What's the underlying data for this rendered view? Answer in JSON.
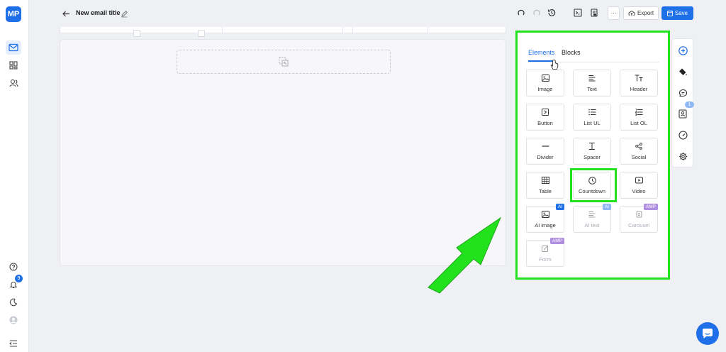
{
  "app": {
    "logo_text": "MP",
    "notification_count": "9"
  },
  "document": {
    "title": "New email title"
  },
  "toolbar": {
    "more_label": "···",
    "export_label": "Export",
    "save_label": "Save"
  },
  "panel": {
    "tabs": [
      {
        "label": "Elements",
        "active": true
      },
      {
        "label": "Blocks",
        "active": false
      }
    ],
    "elements": [
      {
        "label": "Image",
        "icon": "image-icon"
      },
      {
        "label": "Text",
        "icon": "text-lines-icon"
      },
      {
        "label": "Header",
        "icon": "header-tt-icon"
      },
      {
        "label": "Button",
        "icon": "button-icon"
      },
      {
        "label": "List UL",
        "icon": "list-ul-icon"
      },
      {
        "label": "List OL",
        "icon": "list-ol-icon"
      },
      {
        "label": "Divider",
        "icon": "divider-icon"
      },
      {
        "label": "Spacer",
        "icon": "spacer-icon"
      },
      {
        "label": "Social",
        "icon": "share-icon"
      },
      {
        "label": "Table",
        "icon": "table-icon"
      },
      {
        "label": "Countdown",
        "icon": "clock-icon"
      },
      {
        "label": "Video",
        "icon": "video-icon"
      },
      {
        "label": "AI image",
        "icon": "image-icon",
        "tag": "AI"
      },
      {
        "label": "AI text",
        "icon": "text-lines-icon",
        "tag": "AI",
        "disabled": true
      },
      {
        "label": "Carousel",
        "icon": "carousel-icon",
        "tag": "AMP",
        "disabled": true
      },
      {
        "label": "Form",
        "icon": "form-icon",
        "tag": "AMP",
        "disabled": true
      }
    ]
  },
  "right_rail": {
    "badge": "1"
  },
  "colors": {
    "accent": "#1e6fe8",
    "highlight": "#22e11d"
  }
}
